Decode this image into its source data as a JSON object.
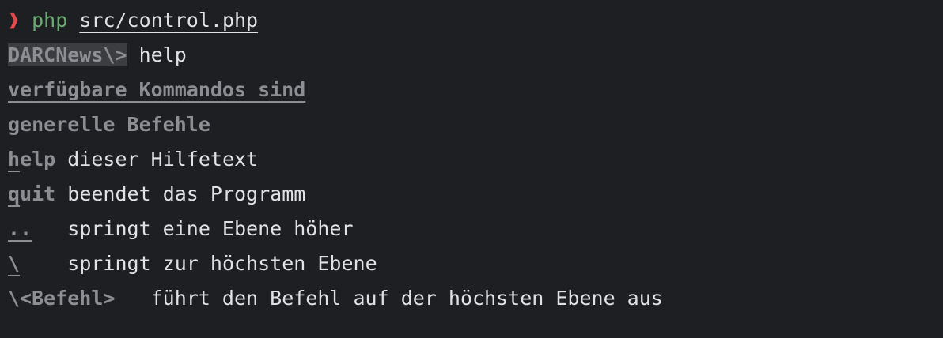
{
  "shell": {
    "prompt_symbol": "❱",
    "command": "php",
    "argument": "src/control.php"
  },
  "app_prompt": {
    "label": "DARCNews\\>",
    "input": "help"
  },
  "help": {
    "heading": "verfügbare Kommandos sind",
    "section": "generelle Befehle",
    "entries": [
      {
        "key_ul": "h",
        "key_rest": "elp",
        "gap": " ",
        "desc": "dieser Hilfetext"
      },
      {
        "key_ul": "q",
        "key_rest": "uit",
        "gap": " ",
        "desc": "beendet das Programm"
      },
      {
        "key_ul": "..",
        "key_rest": "",
        "gap": "   ",
        "desc": "springt eine Ebene höher"
      },
      {
        "key_ul": "\\",
        "key_rest": "",
        "gap": "    ",
        "desc": "springt zur höchsten Ebene"
      },
      {
        "key_ul": "",
        "key_rest": "\\<Befehl>",
        "gap": "   ",
        "desc": "führt den Befehl auf der höchsten Ebene aus"
      }
    ]
  },
  "colors": {
    "background": "#1e1f22",
    "prompt_symbol": "#e5484d",
    "command": "#6aab73",
    "dim_text": "#8c8e93",
    "text": "#dfe1e5"
  }
}
